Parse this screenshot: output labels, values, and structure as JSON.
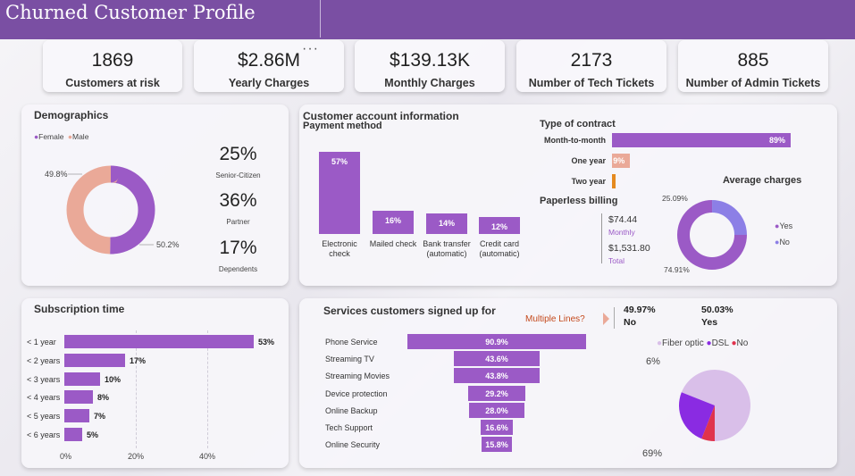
{
  "title": "Churned Customer Profile",
  "kpis": [
    {
      "value": "1869",
      "label": "Customers at risk"
    },
    {
      "value": "$2.86M",
      "label": "Yearly Charges"
    },
    {
      "value": "$139.13K",
      "label": "Monthly Charges"
    },
    {
      "value": "2173",
      "label": "Number of Tech Tickets"
    },
    {
      "value": "885",
      "label": "Number of Admin Tickets"
    }
  ],
  "more_options": "···",
  "demographics": {
    "title": "Demographics",
    "legend": [
      "Female",
      "Male"
    ],
    "female_pct": "50.2%",
    "male_pct": "49.8%",
    "stats": [
      {
        "value": "25%",
        "label": "Senior-Citizen"
      },
      {
        "value": "36%",
        "label": "Partner"
      },
      {
        "value": "17%",
        "label": "Dependents"
      }
    ],
    "colors": {
      "female": "#9b5ac6",
      "male": "#eaa998"
    }
  },
  "account": {
    "title": "Customer account information",
    "payment_title": "Payment method",
    "payment": [
      {
        "name": "Electronic check",
        "line1": "Electronic",
        "line2": "check",
        "value": 57,
        "label": "57%"
      },
      {
        "name": "Mailed check",
        "line1": "Mailed check",
        "line2": "",
        "value": 16,
        "label": "16%"
      },
      {
        "name": "Bank transfer (automatic)",
        "line1": "Bank transfer",
        "line2": "(automatic)",
        "value": 14,
        "label": "14%"
      },
      {
        "name": "Credit card (automatic)",
        "line1": "Credit card",
        "line2": "(automatic)",
        "value": 12,
        "label": "12%"
      }
    ],
    "contract_title": "Type of contract",
    "contracts": [
      {
        "name": "Month-to-month",
        "value": 89,
        "label": "89%",
        "color": "#9b5ac6"
      },
      {
        "name": "One year",
        "value": 9,
        "label": "9%",
        "color": "#eaa998"
      },
      {
        "name": "Two year",
        "value": 2,
        "label": "",
        "color": "#e58a1f"
      }
    ],
    "paperless_title": "Paperless billing",
    "monthly_value": "$74.44",
    "monthly_label": "Monthly",
    "total_value": "$1,531.80",
    "total_label": "Total",
    "avg_title": "Average charges",
    "avg_yes_pct": "74.91%",
    "avg_no_pct": "25.09%",
    "avg_legend": [
      "Yes",
      "No"
    ],
    "colors": {
      "yes": "#9b5ac6",
      "no": "#8c7fe6"
    }
  },
  "subscription": {
    "title": "Subscription time",
    "axis_ticks": [
      "0%",
      "20%",
      "40%"
    ]
  },
  "services": {
    "title": "Services customers signed up for",
    "multiple_lines_label": "Multiple Lines?",
    "no_pct": "49.97%",
    "no_label": "No",
    "yes_pct": "50.03%",
    "yes_label": "Yes",
    "pie_legend": [
      {
        "name": "Fiber optic",
        "color": "#d9bfe9"
      },
      {
        "name": "DSL",
        "color": "#8a2be2"
      },
      {
        "name": "No",
        "color": "#e0334d"
      }
    ]
  },
  "chart_data": [
    {
      "type": "bar",
      "orientation": "horizontal",
      "categories": [
        "< 1 year",
        "< 2 years",
        "< 3 years",
        "< 4 years",
        "< 5 years",
        "< 6 years"
      ],
      "values": [
        53,
        17,
        10,
        8,
        7,
        5
      ],
      "labels": [
        "53%",
        "17%",
        "10%",
        "8%",
        "7%",
        "5%"
      ],
      "xlim": [
        0,
        55
      ],
      "color": "#9b5ac6"
    },
    {
      "type": "bar",
      "orientation": "horizontal-funnel",
      "categories": [
        "Phone Service",
        "Streaming TV",
        "Streaming Movies",
        "Device protection",
        "Online Backup",
        "Tech Support",
        "Online Security"
      ],
      "values": [
        90.9,
        43.6,
        43.8,
        29.2,
        28.0,
        16.6,
        15.8
      ],
      "labels": [
        "90.9%",
        "43.6%",
        "43.8%",
        "29.2%",
        "28.0%",
        "16.6%",
        "15.8%"
      ],
      "color": "#9b5ac6"
    },
    {
      "type": "pie",
      "categories": [
        "Fiber optic",
        "DSL",
        "No"
      ],
      "values": [
        69,
        25,
        6
      ],
      "labels": [
        "69%",
        "25%",
        "6%"
      ],
      "colors": [
        "#d9bfe9",
        "#8a2be2",
        "#e0334d"
      ]
    }
  ]
}
